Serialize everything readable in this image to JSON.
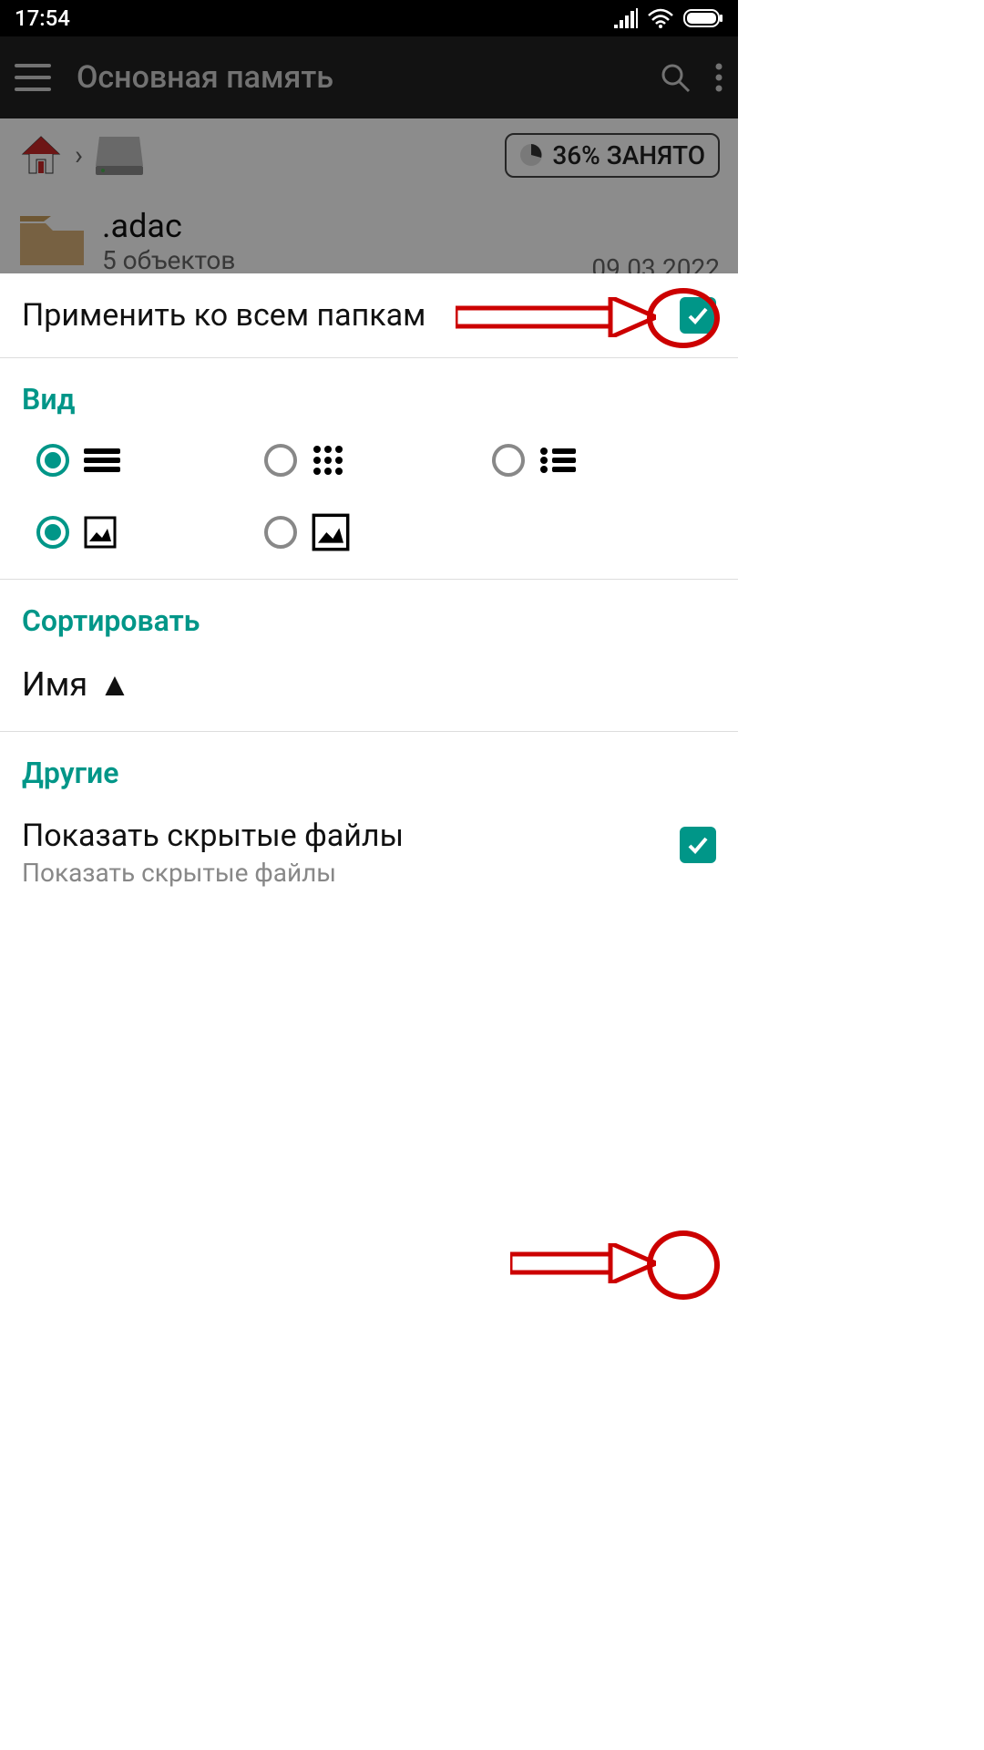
{
  "status": {
    "time": "17:54"
  },
  "appbar": {
    "title": "Основная память"
  },
  "crumb": {
    "storage_label": "36% ЗАНЯТО"
  },
  "file": {
    "name": ".adac",
    "sub": "5 объектов",
    "date": "09.03.2022"
  },
  "sheet": {
    "apply_all": {
      "label": "Применить ко всем папкам",
      "checked": true
    },
    "view": {
      "header": "Вид"
    },
    "sort": {
      "header": "Сортировать",
      "value": "Имя",
      "dir": "▲"
    },
    "other": {
      "header": "Другие",
      "hidden_title": "Показать скрытые файлы",
      "hidden_sub": "Показать скрытые файлы",
      "hidden_checked": true
    }
  }
}
